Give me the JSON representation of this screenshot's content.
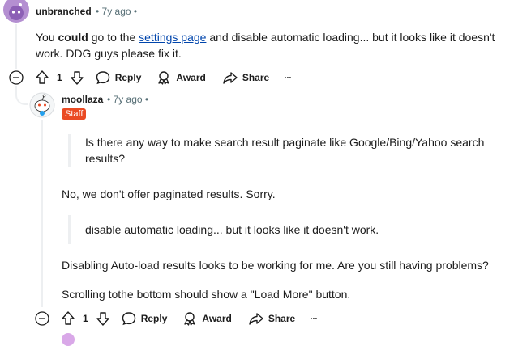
{
  "comment1": {
    "username": "unbranched",
    "time": "7y ago",
    "text_before_bold": "You ",
    "bold": "could",
    "text_mid": " go to the ",
    "link": "settings page",
    "text_after": " and disable automatic loading... but it looks like it doesn't work. DDG guys please fix it.",
    "votes": "1",
    "reply_label": "Reply",
    "award_label": "Award",
    "share_label": "Share",
    "more_label": "···"
  },
  "comment2": {
    "username": "moollaza",
    "time": "7y ago",
    "badge": "Staff",
    "quote1": "Is there any way to make search result paginate like Google/Bing/Yahoo search results?",
    "para1": "No, we don't offer paginated results. Sorry.",
    "quote2": "disable automatic loading... but it looks like it doesn't work.",
    "para2": "Disabling Auto-load results looks to be working for me. Are you still having problems?",
    "para3": "Scrolling tothe bottom should show a \"Load More\" button.",
    "votes": "1",
    "reply_label": "Reply",
    "award_label": "Award",
    "share_label": "Share",
    "more_label": "···"
  },
  "colors": {
    "staff": "#ea4a23",
    "link": "#0045ac",
    "avatar1": "#b48fd1"
  }
}
